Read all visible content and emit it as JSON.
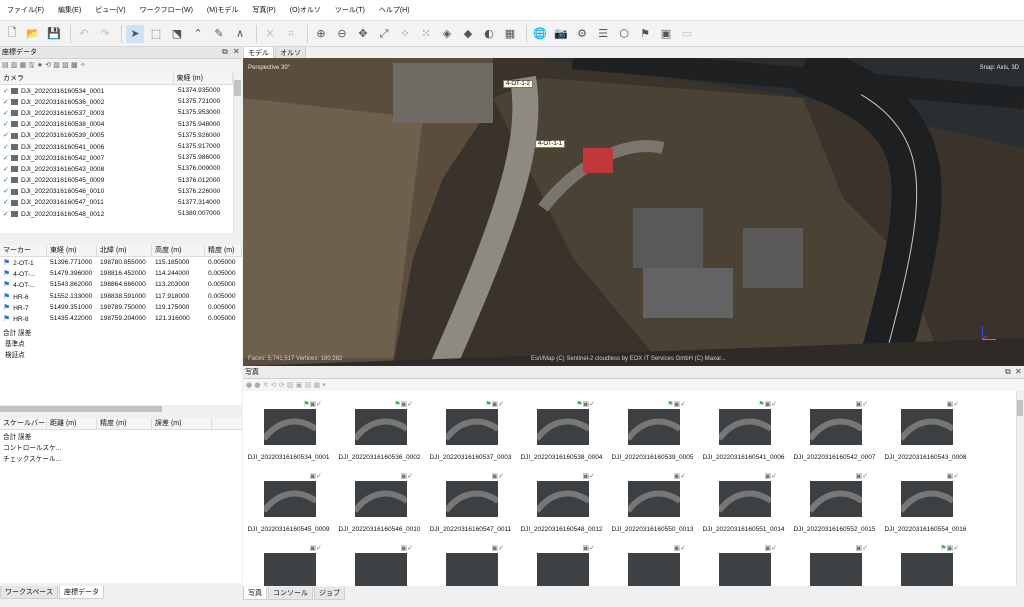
{
  "menu": [
    "ファイル(F)",
    "編集(E)",
    "ビュー(V)",
    "ワークフロー(W)",
    "(M)モデル",
    "写真(P)",
    "(O)オルソ",
    "ツール(T)",
    "ヘルプ(H)"
  ],
  "left_top": {
    "title": "座標データ",
    "columns": [
      "カメラ",
      "東経 (m)"
    ],
    "rows": [
      {
        "name": "DJI_20220316160534_0001",
        "east": "51374.935000"
      },
      {
        "name": "DJI_20220316160536_0002",
        "east": "51375.721000"
      },
      {
        "name": "DJI_20220316160537_0003",
        "east": "51375.953000"
      },
      {
        "name": "DJI_20220316160538_0004",
        "east": "51375.948000"
      },
      {
        "name": "DJI_20220316160539_0005",
        "east": "51375.926000"
      },
      {
        "name": "DJI_20220316160541_0006",
        "east": "51375.917000"
      },
      {
        "name": "DJI_20220316160542_0007",
        "east": "51375.986000"
      },
      {
        "name": "DJI_20220316160543_0008",
        "east": "51376.009000"
      },
      {
        "name": "DJI_20220316160545_0009",
        "east": "51376.012000"
      },
      {
        "name": "DJI_20220316160546_0010",
        "east": "51376.226000"
      },
      {
        "name": "DJI_20220316160547_0011",
        "east": "51377.314000"
      },
      {
        "name": "DJI_20220316160548_0012",
        "east": "51380.007000"
      }
    ]
  },
  "markers": {
    "columns": [
      "マーカー",
      "東経 (m)",
      "北緯 (m)",
      "高度 (m)",
      "精度 (m)"
    ],
    "rows": [
      {
        "name": "2-OT-1",
        "east": "51396.771000",
        "north": "198780.855000",
        "alt": "115.185000",
        "acc": "0.005000"
      },
      {
        "name": "4-OT-...",
        "east": "51479.396000",
        "north": "198816.452000",
        "alt": "114.244000",
        "acc": "0.005000"
      },
      {
        "name": "4-OT-...",
        "east": "51543.862000",
        "north": "198864.666000",
        "alt": "113.203000",
        "acc": "0.005000"
      },
      {
        "name": "HR-6",
        "east": "51552.133000",
        "north": "198838.591000",
        "alt": "117.918000",
        "acc": "0.005000"
      },
      {
        "name": "HR-7",
        "east": "51499.351000",
        "north": "198789.750000",
        "alt": "119.175000",
        "acc": "0.005000"
      },
      {
        "name": "HR-8",
        "east": "51435.422000",
        "north": "198759.204000",
        "alt": "121.316000",
        "acc": "0.005000"
      }
    ],
    "total": "合計 誤差",
    "ref": "基準点",
    "check": "検証点"
  },
  "scalebars": {
    "columns": [
      "スケールバー",
      "距離 (m)",
      "精度 (m)",
      "誤差 (m)"
    ],
    "total": "合計 誤差",
    "control": "コントロールスケ...",
    "checkscale": "チェックスケール..."
  },
  "bottom_tabs_left": [
    "ワークスペース",
    "座標データ"
  ],
  "view": {
    "tabs": [
      "モデル",
      "オルソ"
    ],
    "perspective": "Perspective 30°",
    "snap": "Snap: Axis, 3D",
    "stats": "Faces: 5,741,517 Vertices: 180,282",
    "attribution": "Esri/Map (C) Sentinel-2 cloudless by EOX IT Services GmbH (C) Maxar...",
    "labels": [
      "4-OT-1-2",
      "4-OT-1-1"
    ]
  },
  "photos": {
    "title": "写真",
    "tabs": [
      "写真",
      "コンソール",
      "ジョブ"
    ],
    "row1": [
      "DJI_20220316160534_0001",
      "DJI_20220316160536_0002",
      "DJI_20220316160537_0003",
      "DJI_20220316160538_0004",
      "DJI_20220316160539_0005",
      "DJI_20220316160541_0006",
      "DJI_20220316160542_0007",
      "DJI_20220316160543_0008"
    ],
    "row2": [
      "DJI_20220316160545_0009",
      "DJI_20220316160546_0010",
      "DJI_20220316160547_0011",
      "DJI_20220316160548_0012",
      "DJI_20220316160550_0013",
      "DJI_20220316160551_0014",
      "DJI_20220316160552_0015",
      "DJI_20220316160554_0016"
    ]
  },
  "colors": {
    "flag_green": "#35b04a",
    "marker_blue": "#2a6fd6",
    "selection": "#cfe3f6"
  }
}
